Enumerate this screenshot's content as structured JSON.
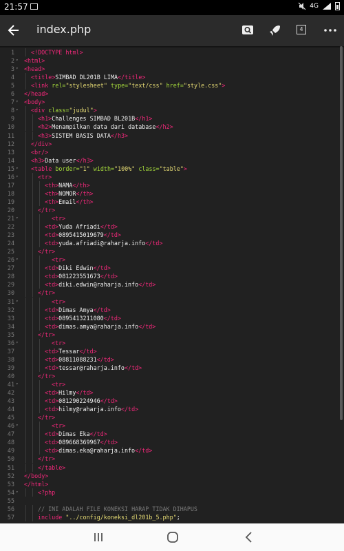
{
  "status_bar": {
    "time": "21:57",
    "network": "4G",
    "icons": [
      "image-icon",
      "mute-icon",
      "signal-icon",
      "battery-icon"
    ]
  },
  "app_bar": {
    "title": "index.php",
    "tab_count": "4",
    "icons": [
      "back-arrow-icon",
      "search-icon",
      "rocket-icon",
      "tabs-icon",
      "more-icon"
    ]
  },
  "editor": {
    "lines": [
      {
        "n": "1",
        "f": "",
        "i": 1,
        "t": [
          [
            "t",
            "<!DOCTYPE html>"
          ]
        ]
      },
      {
        "n": "2",
        "f": "▾",
        "i": 0,
        "t": [
          [
            "t",
            "<html>"
          ]
        ]
      },
      {
        "n": "3",
        "f": "▾",
        "i": 0,
        "t": [
          [
            "t",
            "<head>"
          ]
        ]
      },
      {
        "n": "4",
        "f": "",
        "i": 1,
        "t": [
          [
            "t",
            "<title>"
          ],
          [
            "x",
            "SIMBAD DL201B LIMA"
          ],
          [
            "t",
            "</title>"
          ]
        ]
      },
      {
        "n": "5",
        "f": "",
        "i": 1,
        "t": [
          [
            "t",
            "<link "
          ],
          [
            "a",
            "rel="
          ],
          [
            "s",
            "\"stylesheet\""
          ],
          [
            "a",
            " type="
          ],
          [
            "s",
            "\"text/css\""
          ],
          [
            "a",
            " href="
          ],
          [
            "s",
            "\"style.css\""
          ],
          [
            "t",
            ">"
          ]
        ]
      },
      {
        "n": "6",
        "f": "",
        "i": 0,
        "t": [
          [
            "t",
            "</head>"
          ]
        ]
      },
      {
        "n": "7",
        "f": "▾",
        "i": 0,
        "t": [
          [
            "t",
            "<body>"
          ]
        ]
      },
      {
        "n": "8",
        "f": "▾",
        "i": 1,
        "t": [
          [
            "t",
            "<div "
          ],
          [
            "a",
            "class="
          ],
          [
            "s",
            "\"judul\""
          ],
          [
            "t",
            ">"
          ]
        ]
      },
      {
        "n": "9",
        "f": "",
        "i": 2,
        "t": [
          [
            "t",
            "<h1>"
          ],
          [
            "x",
            "Challenges SIMBAD BL201B"
          ],
          [
            "t",
            "</h1>"
          ]
        ]
      },
      {
        "n": "10",
        "f": "",
        "i": 2,
        "t": [
          [
            "t",
            "<h2>"
          ],
          [
            "x",
            "Menampilkan data dari database"
          ],
          [
            "t",
            "</h2>"
          ]
        ]
      },
      {
        "n": "11",
        "f": "",
        "i": 2,
        "t": [
          [
            "t",
            "<h3>"
          ],
          [
            "x",
            "SISTEM BASIS DATA"
          ],
          [
            "t",
            "</h3>"
          ]
        ]
      },
      {
        "n": "12",
        "f": "",
        "i": 1,
        "t": [
          [
            "t",
            "</div>"
          ]
        ]
      },
      {
        "n": "13",
        "f": "",
        "i": 1,
        "t": [
          [
            "t",
            "<br/>"
          ]
        ]
      },
      {
        "n": "14",
        "f": "",
        "i": 1,
        "t": [
          [
            "t",
            "<h3>"
          ],
          [
            "x",
            "Data user"
          ],
          [
            "t",
            "</h3>"
          ]
        ]
      },
      {
        "n": "15",
        "f": "▾",
        "i": 1,
        "t": [
          [
            "t",
            "<table "
          ],
          [
            "a",
            "border="
          ],
          [
            "s",
            "\"1\""
          ],
          [
            "a",
            " width="
          ],
          [
            "s",
            "\"100%\""
          ],
          [
            "a",
            " class="
          ],
          [
            "s",
            "\"table\""
          ],
          [
            "t",
            ">"
          ]
        ]
      },
      {
        "n": "16",
        "f": "▾",
        "i": 2,
        "t": [
          [
            "t",
            "<tr>"
          ]
        ]
      },
      {
        "n": "17",
        "f": "",
        "i": 3,
        "t": [
          [
            "t",
            "<th>"
          ],
          [
            "x",
            "NAMA"
          ],
          [
            "t",
            "</th>"
          ]
        ]
      },
      {
        "n": "18",
        "f": "",
        "i": 3,
        "t": [
          [
            "t",
            "<th>"
          ],
          [
            "x",
            "NOMOR"
          ],
          [
            "t",
            "</th>"
          ]
        ]
      },
      {
        "n": "19",
        "f": "",
        "i": 3,
        "t": [
          [
            "t",
            "<th>"
          ],
          [
            "x",
            "Email"
          ],
          [
            "t",
            "</th>"
          ]
        ]
      },
      {
        "n": "20",
        "f": "",
        "i": 2,
        "t": [
          [
            "t",
            "</tr>"
          ]
        ]
      },
      {
        "n": "21",
        "f": "▾",
        "i": 4,
        "t": [
          [
            "t",
            "<tr>"
          ]
        ]
      },
      {
        "n": "22",
        "f": "",
        "i": 3,
        "t": [
          [
            "t",
            "<td>"
          ],
          [
            "x",
            "Yuda Afriadi"
          ],
          [
            "t",
            "</td>"
          ]
        ]
      },
      {
        "n": "23",
        "f": "",
        "i": 3,
        "t": [
          [
            "t",
            "<td>"
          ],
          [
            "x",
            "0895415019679"
          ],
          [
            "t",
            "</td>"
          ]
        ]
      },
      {
        "n": "24",
        "f": "",
        "i": 3,
        "t": [
          [
            "t",
            "<td>"
          ],
          [
            "x",
            "yuda.afriadi@raharja.info"
          ],
          [
            "t",
            "</td>"
          ]
        ]
      },
      {
        "n": "25",
        "f": "",
        "i": 2,
        "t": [
          [
            "t",
            "</tr>"
          ]
        ]
      },
      {
        "n": "26",
        "f": "▾",
        "i": 4,
        "t": [
          [
            "t",
            "<tr>"
          ]
        ]
      },
      {
        "n": "27",
        "f": "",
        "i": 3,
        "t": [
          [
            "t",
            "<td>"
          ],
          [
            "x",
            "Diki Edwin"
          ],
          [
            "t",
            "</td>"
          ]
        ]
      },
      {
        "n": "28",
        "f": "",
        "i": 3,
        "t": [
          [
            "t",
            "<td>"
          ],
          [
            "x",
            "081223551673"
          ],
          [
            "t",
            "</td>"
          ]
        ]
      },
      {
        "n": "29",
        "f": "",
        "i": 3,
        "t": [
          [
            "t",
            "<td>"
          ],
          [
            "x",
            "diki.edwin@raharja.info"
          ],
          [
            "t",
            "</td>"
          ]
        ]
      },
      {
        "n": "30",
        "f": "",
        "i": 2,
        "t": [
          [
            "t",
            "</tr>"
          ]
        ]
      },
      {
        "n": "31",
        "f": "▾",
        "i": 4,
        "t": [
          [
            "t",
            "<tr>"
          ]
        ]
      },
      {
        "n": "32",
        "f": "",
        "i": 3,
        "t": [
          [
            "t",
            "<td>"
          ],
          [
            "x",
            "Dimas Amya"
          ],
          [
            "t",
            "</td>"
          ]
        ]
      },
      {
        "n": "33",
        "f": "",
        "i": 3,
        "t": [
          [
            "t",
            "<td>"
          ],
          [
            "x",
            "0895413211080"
          ],
          [
            "t",
            "</td>"
          ]
        ]
      },
      {
        "n": "34",
        "f": "",
        "i": 3,
        "t": [
          [
            "t",
            "<td>"
          ],
          [
            "x",
            "dimas.amya@raharja.info"
          ],
          [
            "t",
            "</td>"
          ]
        ]
      },
      {
        "n": "35",
        "f": "",
        "i": 2,
        "t": [
          [
            "t",
            "</tr>"
          ]
        ]
      },
      {
        "n": "36",
        "f": "▾",
        "i": 4,
        "t": [
          [
            "t",
            "<tr>"
          ]
        ]
      },
      {
        "n": "37",
        "f": "",
        "i": 3,
        "t": [
          [
            "t",
            "<td>"
          ],
          [
            "x",
            "Tessar"
          ],
          [
            "t",
            "</td>"
          ]
        ]
      },
      {
        "n": "38",
        "f": "",
        "i": 3,
        "t": [
          [
            "t",
            "<td>"
          ],
          [
            "x",
            "08811088231"
          ],
          [
            "t",
            "</td>"
          ]
        ]
      },
      {
        "n": "39",
        "f": "",
        "i": 3,
        "t": [
          [
            "t",
            "<td>"
          ],
          [
            "x",
            "tessar@raharja.info"
          ],
          [
            "t",
            "</td>"
          ]
        ]
      },
      {
        "n": "40",
        "f": "",
        "i": 2,
        "t": [
          [
            "t",
            "</tr>"
          ]
        ]
      },
      {
        "n": "41",
        "f": "▾",
        "i": 4,
        "t": [
          [
            "t",
            "<tr>"
          ]
        ]
      },
      {
        "n": "42",
        "f": "",
        "i": 3,
        "t": [
          [
            "t",
            "<td>"
          ],
          [
            "x",
            "Hilmy"
          ],
          [
            "t",
            "</td>"
          ]
        ]
      },
      {
        "n": "43",
        "f": "",
        "i": 3,
        "t": [
          [
            "t",
            "<td>"
          ],
          [
            "x",
            "081290224946"
          ],
          [
            "t",
            "</td>"
          ]
        ]
      },
      {
        "n": "44",
        "f": "",
        "i": 3,
        "t": [
          [
            "t",
            "<td>"
          ],
          [
            "x",
            "hilmy@raharja.info"
          ],
          [
            "t",
            "</td>"
          ]
        ]
      },
      {
        "n": "45",
        "f": "",
        "i": 2,
        "t": [
          [
            "t",
            "</tr>"
          ]
        ]
      },
      {
        "n": "46",
        "f": "▾",
        "i": 4,
        "t": [
          [
            "t",
            "<tr>"
          ]
        ]
      },
      {
        "n": "47",
        "f": "",
        "i": 3,
        "t": [
          [
            "t",
            "<td>"
          ],
          [
            "x",
            "Dimas Eka"
          ],
          [
            "t",
            "</td>"
          ]
        ]
      },
      {
        "n": "48",
        "f": "",
        "i": 3,
        "t": [
          [
            "t",
            "<td>"
          ],
          [
            "x",
            "089668369967"
          ],
          [
            "t",
            "</td>"
          ]
        ]
      },
      {
        "n": "49",
        "f": "",
        "i": 3,
        "t": [
          [
            "t",
            "<td>"
          ],
          [
            "x",
            "dimas.eka@raharja.info"
          ],
          [
            "t",
            "</td>"
          ]
        ]
      },
      {
        "n": "50",
        "f": "",
        "i": 2,
        "t": [
          [
            "t",
            "</tr>"
          ]
        ]
      },
      {
        "n": "51",
        "f": "",
        "i": 2,
        "t": [
          [
            "t",
            "</table>"
          ]
        ]
      },
      {
        "n": "52",
        "f": "",
        "i": 0,
        "t": [
          [
            "t",
            "</body>"
          ]
        ]
      },
      {
        "n": "53",
        "f": "",
        "i": 0,
        "t": [
          [
            "t",
            "</html>"
          ]
        ]
      },
      {
        "n": "54",
        "f": "▾",
        "i": 2,
        "t": [
          [
            "t",
            "<?php"
          ]
        ]
      },
      {
        "n": "55",
        "f": "",
        "i": 0,
        "t": []
      },
      {
        "n": "56",
        "f": "",
        "i": 2,
        "t": [
          [
            "c",
            "// INI ADALAH FILE KONEKSI HARAP TIDAK DIHAPUS"
          ]
        ]
      },
      {
        "n": "57",
        "f": "",
        "i": 2,
        "t": [
          [
            "t",
            "include "
          ],
          [
            "s",
            "\"../config/koneksi_dl201b_5.php\""
          ],
          [
            "x",
            ";"
          ]
        ]
      }
    ]
  },
  "nav_bar": {
    "icons": [
      "recent-apps-icon",
      "home-icon",
      "back-icon"
    ]
  }
}
